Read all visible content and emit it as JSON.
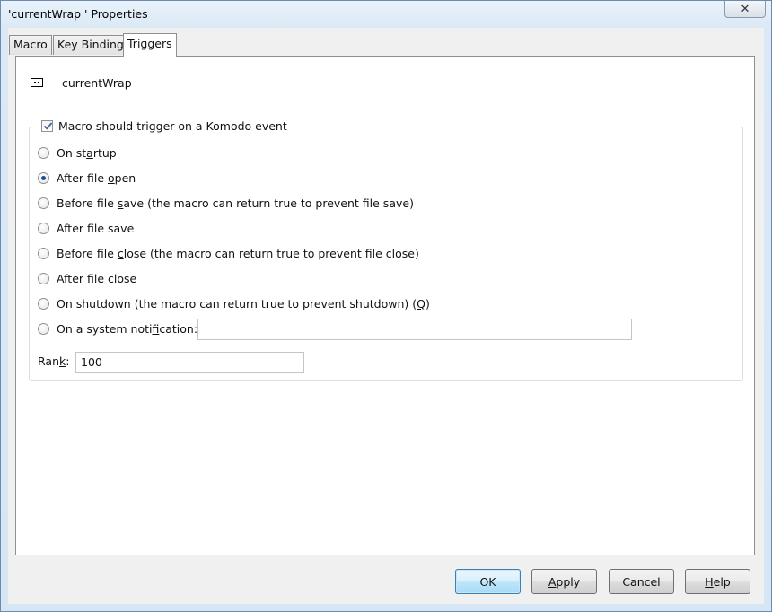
{
  "window": {
    "title": "'currentWrap ' Properties",
    "close_glyph": "✕"
  },
  "tabs": [
    {
      "label": "Macro",
      "active": false
    },
    {
      "label": "Key Binding",
      "active": false
    },
    {
      "label": "Triggers",
      "active": true
    }
  ],
  "header": {
    "macro_icon": "macro-icon",
    "macro_name": "currentWrap"
  },
  "trigger_group": {
    "enable_label": "Macro should trigger on a Komodo event",
    "enabled": true,
    "options": [
      {
        "pre": "On st",
        "key": "a",
        "post": "rtup",
        "checked": false
      },
      {
        "pre": "After file ",
        "key": "o",
        "post": "pen",
        "checked": true
      },
      {
        "pre": "Before file ",
        "key": "s",
        "post": "ave (the macro can return true to prevent file save)",
        "checked": false
      },
      {
        "pre": "After file save",
        "key": "",
        "post": "",
        "checked": false
      },
      {
        "pre": "Before file ",
        "key": "c",
        "post": "lose (the macro can return true to prevent file close)",
        "checked": false
      },
      {
        "pre": "After file close",
        "key": "",
        "post": "",
        "checked": false
      },
      {
        "pre": "On shutdown (the macro can return true to prevent shutdown) (",
        "key": "Q",
        "post": ")",
        "checked": false
      },
      {
        "pre": "On a system noti",
        "key": "f",
        "post": "ication:",
        "checked": false
      }
    ],
    "notification_value": "",
    "rank": {
      "pre": "Ran",
      "key": "k",
      "post": ":",
      "value": "100"
    }
  },
  "buttons": {
    "ok": {
      "pre": "OK",
      "key": "",
      "post": ""
    },
    "apply": {
      "pre": "",
      "key": "A",
      "post": "pply"
    },
    "cancel": {
      "pre": "Cancel",
      "key": "",
      "post": ""
    },
    "help": {
      "pre": "",
      "key": "H",
      "post": "elp"
    }
  },
  "colors": {
    "frame": "#d6e6f5",
    "accent": "#3c7fb1",
    "radio_dot": "#1b4f9c"
  }
}
